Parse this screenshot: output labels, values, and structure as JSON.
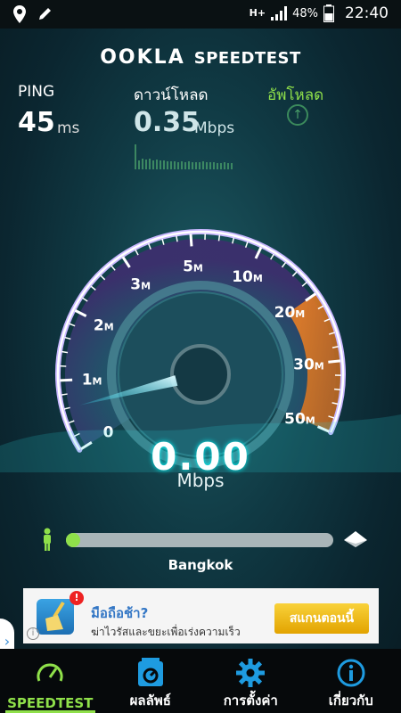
{
  "status": {
    "network": "H+",
    "battery": "48%",
    "time": "22:40"
  },
  "brand": {
    "ookla": "OOKLA",
    "speedtest": "SPEEDTEST"
  },
  "stats": {
    "ping_label": "PING",
    "ping_value": "45",
    "ping_unit": "ms",
    "download_label": "ดาวน์โหลด",
    "download_value": "0.35",
    "download_unit": "Mbps",
    "upload_label": "อัพโหลด"
  },
  "gauge": {
    "ticks": [
      "0",
      "1M",
      "2M",
      "3M",
      "5M",
      "10M",
      "20M",
      "30M",
      "50M"
    ],
    "current_speed": "0.00",
    "unit": "Mbps",
    "needle_value_mbps": 0.6
  },
  "server": {
    "city": "Bangkok",
    "progress": 0
  },
  "ad": {
    "title": "มือถือช้า?",
    "description": "ฆ่าไวรัสและขยะเพื่อเร่งความเร็ว",
    "cta": "สแกนตอนนี้",
    "badge": "!",
    "info": "i"
  },
  "nav": [
    {
      "label": "SPEEDTEST",
      "icon": "gauge-icon",
      "active": true
    },
    {
      "label": "ผลลัพธ์",
      "icon": "results-icon",
      "active": false
    },
    {
      "label": "การตั้งค่า",
      "icon": "gear-icon",
      "active": false
    },
    {
      "label": "เกี่ยวกับ",
      "icon": "info-icon",
      "active": false
    }
  ],
  "colors": {
    "accent": "#8fe04a",
    "gauge_outline": "#c9b8ff",
    "gauge_orange": "#e8892a",
    "button_yellow": "#f2bb14"
  }
}
